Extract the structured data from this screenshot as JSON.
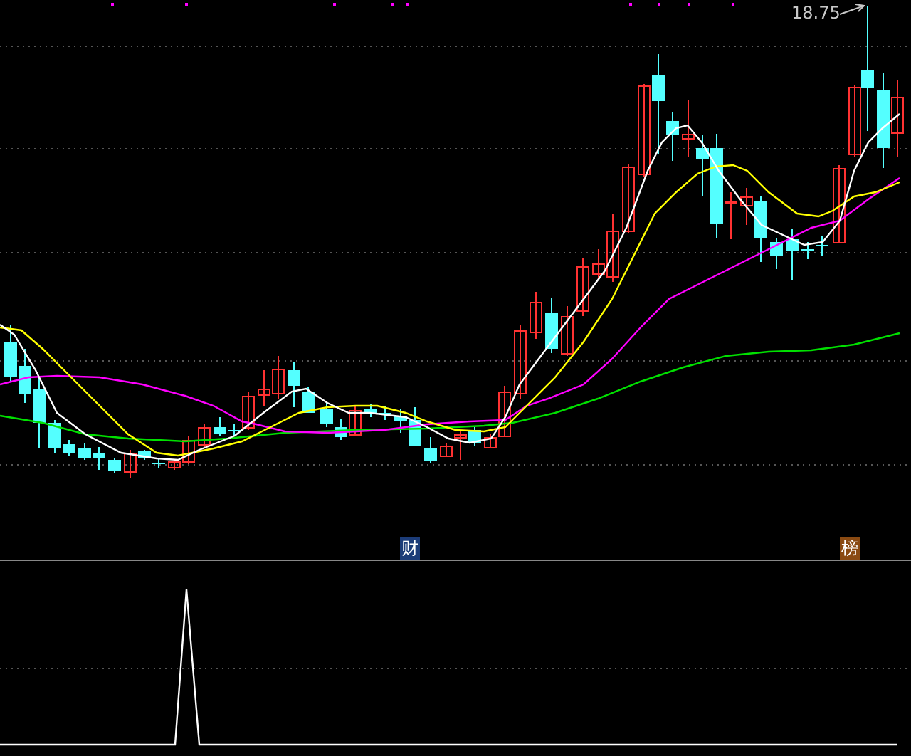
{
  "price_chart": {
    "high_label": "18.75",
    "markers": [
      {
        "label": "财",
        "color": "#1c3c78"
      },
      {
        "label": "榜",
        "color": "#8a4a12"
      }
    ]
  }
}
